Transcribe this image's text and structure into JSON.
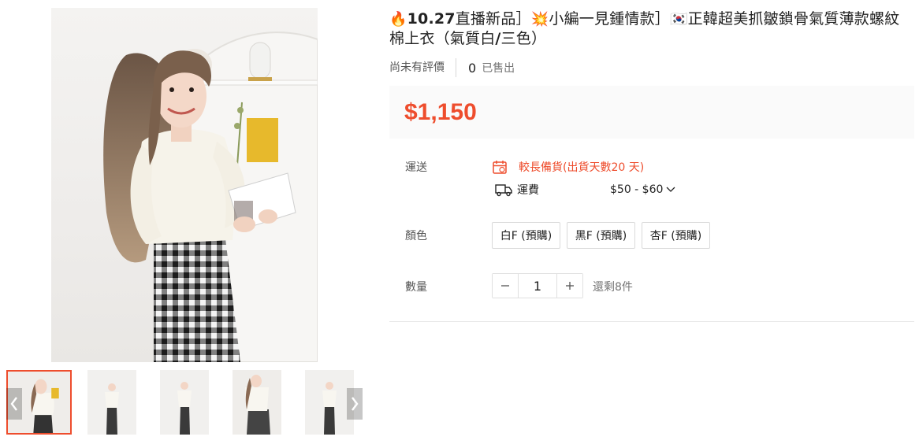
{
  "product": {
    "title_part1": "🔥",
    "title_bold1": "10.27",
    "title_part2": "直播新品］",
    "title_emoji2": "💥",
    "title_part3": "小編一見鍾情款］",
    "title_emoji3": "🇰🇷",
    "title_part4": "正韓超美抓皺鎖骨氣質薄款螺紋棉上衣（氣質白",
    "title_bold2": "/",
    "title_part5": "三色）",
    "rating_text": "尚未有評價",
    "sold_count": "0",
    "sold_label": "已售出",
    "price": "$1,150"
  },
  "shipping": {
    "label": "運送",
    "preorder_text": "較長備貨(出貨天數20 天)",
    "fee_label": "運費",
    "fee_range": "$50 - $60"
  },
  "color": {
    "label": "顏色",
    "options": [
      "白F (預購)",
      "黑F (預購)",
      "杏F (預購)"
    ]
  },
  "quantity": {
    "label": "數量",
    "value": "1",
    "stock_text": "還剩8件"
  },
  "icons": {
    "calendar": "calendar-icon",
    "truck": "truck-icon",
    "chevron": "chevron-down-icon",
    "minus": "minus-icon",
    "plus": "plus-icon",
    "prev": "chevron-left-icon",
    "next": "chevron-right-icon"
  },
  "colors": {
    "accent": "#ee4d2d",
    "price_bg": "#fafafa"
  }
}
